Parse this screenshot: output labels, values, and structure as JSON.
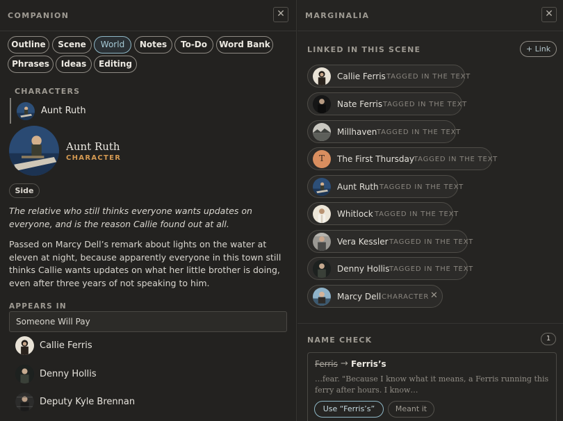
{
  "companion": {
    "title": "COMPANION",
    "close_glyph": "✕",
    "tabs": [
      {
        "label": "Outline",
        "active": false
      },
      {
        "label": "Scene",
        "active": false
      },
      {
        "label": "World",
        "active": true
      },
      {
        "label": "Notes",
        "active": false
      },
      {
        "label": "To-Do",
        "active": false
      },
      {
        "label": "Word Bank",
        "active": false
      },
      {
        "label": "Phrases",
        "active": false
      },
      {
        "label": "Ideas",
        "active": false
      },
      {
        "label": "Editing",
        "active": false
      }
    ],
    "characters_label": "CHARACTERS",
    "selected_character": "Aunt Ruth",
    "profile": {
      "name": "Aunt Ruth",
      "role": "CHARACTER",
      "badge": "Side",
      "tagline": "The relative who still thinks everyone wants updates on everyone, and is the reason Callie found out at all.",
      "description": "Passed on Marcy Dell’s remark about lights on the water at eleven at night, because apparently everyone in this town still thinks Callie wants updates on what her little brother is doing, even after three years of not speaking to him."
    },
    "appears_in_label": "APPEARS IN",
    "scene_select_value": "Someone Will Pay",
    "appearing": [
      "Callie Ferris",
      "Denny Hollis",
      "Deputy Kyle Brennan"
    ]
  },
  "marginalia": {
    "title": "MARGINALIA",
    "close_glyph": "✕",
    "linked_label": "LINKED IN THIS SCENE",
    "link_button": "+ Link",
    "linked": [
      {
        "name": "Callie Ferris",
        "tag": "TAGGED IN THE TEXT"
      },
      {
        "name": "Nate Ferris",
        "tag": "TAGGED IN THE TEXT"
      },
      {
        "name": "Millhaven",
        "tag": "TAGGED IN THE TEXT"
      },
      {
        "name": "The First Thursday",
        "tag": "TAGGED IN THE TEXT",
        "initial": "T"
      },
      {
        "name": "Aunt Ruth",
        "tag": "TAGGED IN THE TEXT"
      },
      {
        "name": "Whitlock",
        "tag": "TAGGED IN THE TEXT"
      },
      {
        "name": "Vera Kessler",
        "tag": "TAGGED IN THE TEXT"
      },
      {
        "name": "Denny Hollis",
        "tag": "TAGGED IN THE TEXT"
      },
      {
        "name": "Marcy Dell",
        "tag": "CHARACTER",
        "remove_glyph": "✕"
      }
    ],
    "name_check": {
      "label": "NAME CHECK",
      "count": "1",
      "original": "Ferris",
      "arrow": "→",
      "suggestion": "Ferris’s",
      "snippet": "…fear. \"Because I know what it means, a Ferris running this ferry after hours. I know…",
      "use_button": "Use “Ferris’s”",
      "dismiss_button": "Meant it"
    }
  },
  "colors": {
    "accent_blue": "#8fb8c7",
    "role_orange": "#d59a52",
    "initial_avatar": "#d98e5f"
  }
}
